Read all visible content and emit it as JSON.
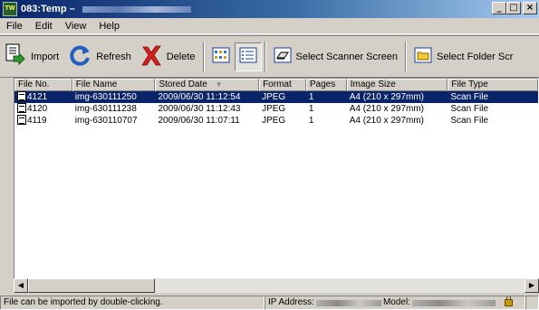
{
  "window": {
    "title": "083:Temp –",
    "minimize": "_",
    "maximize": "□",
    "close": "×",
    "app_icon_text": "TW"
  },
  "menu": [
    "File",
    "Edit",
    "View",
    "Help"
  ],
  "toolbar": {
    "import": "Import",
    "refresh": "Refresh",
    "delete": "Delete",
    "select_scanner": "Select Scanner Screen",
    "select_folder": "Select Folder Scr"
  },
  "columns": [
    "File No.",
    "File Name",
    "Stored Date",
    "Format",
    "Pages",
    "Image Size",
    "File Type"
  ],
  "sort_indicator": "▼",
  "rows": [
    {
      "file_no": "4121",
      "file_name": "img-630111250",
      "stored_date": "2009/06/30 11:12:54",
      "format": "JPEG",
      "pages": "1",
      "image_size": "A4 (210 x 297mm)",
      "file_type": "Scan File",
      "selected": true
    },
    {
      "file_no": "4120",
      "file_name": "img-630111238",
      "stored_date": "2009/06/30 11:12:43",
      "format": "JPEG",
      "pages": "1",
      "image_size": "A4 (210 x 297mm)",
      "file_type": "Scan File",
      "selected": false
    },
    {
      "file_no": "4119",
      "file_name": "img-630110707",
      "stored_date": "2009/06/30 11:07:11",
      "format": "JPEG",
      "pages": "1",
      "image_size": "A4 (210 x 297mm)",
      "file_type": "Scan File",
      "selected": false
    }
  ],
  "status": {
    "hint": "File can be imported by double-clicking.",
    "ip_label": "IP Address:",
    "model_label": "Model:"
  },
  "colors": {
    "selection": "#0a246a",
    "title_start": "#0a246a",
    "title_end": "#a6caf0",
    "chrome": "#d4d0c8"
  },
  "icons": [
    "import-icon",
    "refresh-icon",
    "delete-icon",
    "thumbnail-view-icon",
    "details-view-icon",
    "scanner-icon",
    "folder-icon",
    "lock-icon"
  ]
}
